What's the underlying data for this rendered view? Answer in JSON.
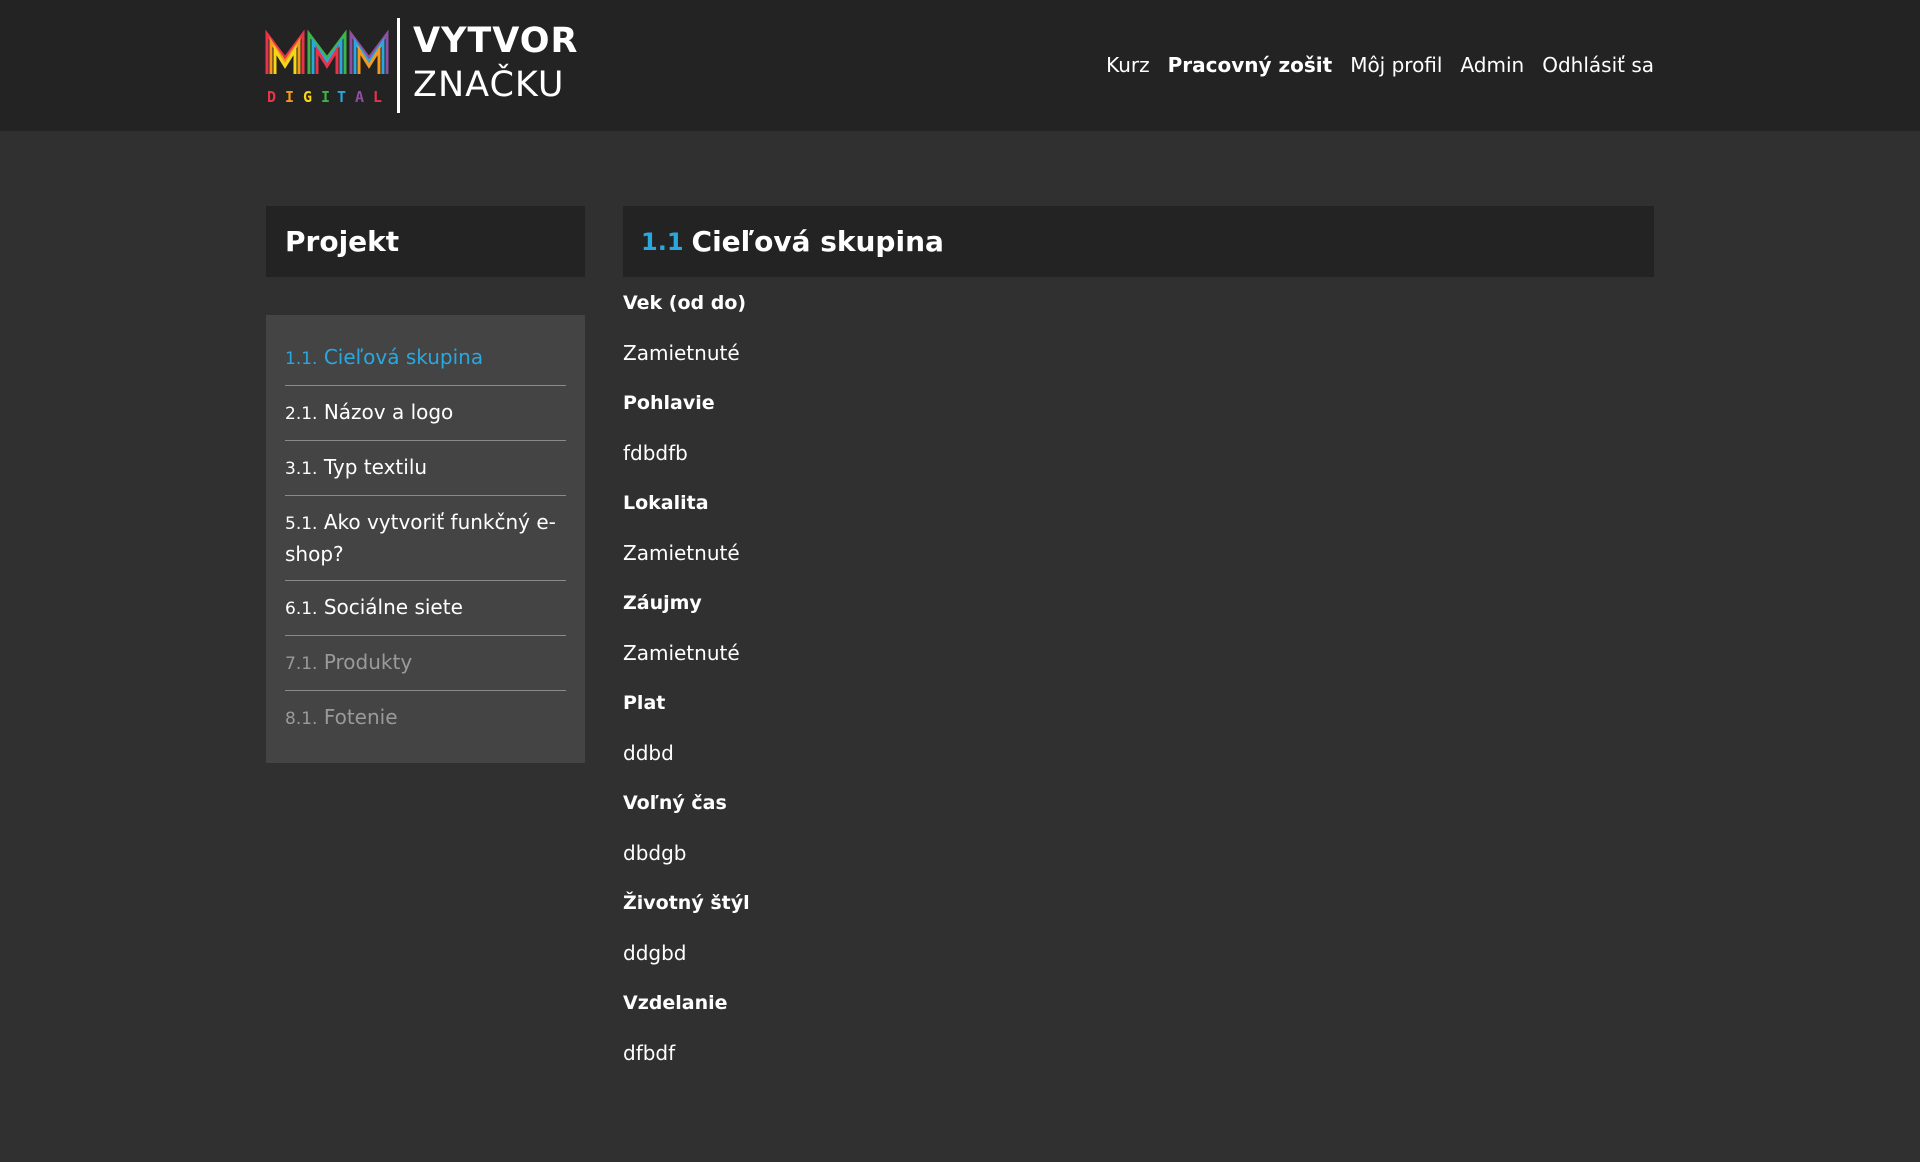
{
  "brand": {
    "word1": "VYTVOR",
    "word2": "ZNAČKU",
    "mark_text": "DIGITAL",
    "mark_colors": [
      "#e8334a",
      "#f39a1e",
      "#f5d61a",
      "#3fb34a",
      "#29a8e0",
      "#8e4fa0",
      "#e8334a"
    ]
  },
  "nav": {
    "items": [
      {
        "label": "Kurz"
      },
      {
        "label": "Pracovný zošit"
      },
      {
        "label": "Môj profil"
      },
      {
        "label": "Admin"
      },
      {
        "label": "Odhlásiť sa"
      }
    ]
  },
  "sidebar": {
    "title": "Projekt",
    "items": [
      {
        "num": "1.1.",
        "label": "Cieľová skupina"
      },
      {
        "num": "2.1.",
        "label": "Názov a logo"
      },
      {
        "num": "3.1.",
        "label": "Typ textilu"
      },
      {
        "num": "5.1.",
        "label": "Ako vytvoriť funkčný e-shop?"
      },
      {
        "num": "6.1.",
        "label": "Sociálne siete"
      },
      {
        "num": "7.1.",
        "label": "Produkty"
      },
      {
        "num": "8.1.",
        "label": "Fotenie"
      }
    ]
  },
  "main": {
    "title_num": "1.1",
    "title": "Cieľová skupina",
    "fields": [
      {
        "label": "Vek (od do)",
        "value": "Zamietnuté"
      },
      {
        "label": "Pohlavie",
        "value": "fdbdfb"
      },
      {
        "label": "Lokalita",
        "value": "Zamietnuté"
      },
      {
        "label": "Záujmy",
        "value": "Zamietnuté"
      },
      {
        "label": "Plat",
        "value": "ddbd"
      },
      {
        "label": "Voľný čas",
        "value": "dbdgb"
      },
      {
        "label": "Životný štýl",
        "value": "ddgbd"
      },
      {
        "label": "Vzdelanie",
        "value": "dfbdf"
      }
    ]
  },
  "colors": {
    "accent": "#29a8e0",
    "header_bg": "#232323",
    "page_bg": "#303030",
    "sidebar_bg": "#454444",
    "muted": "#9a9a9a"
  }
}
